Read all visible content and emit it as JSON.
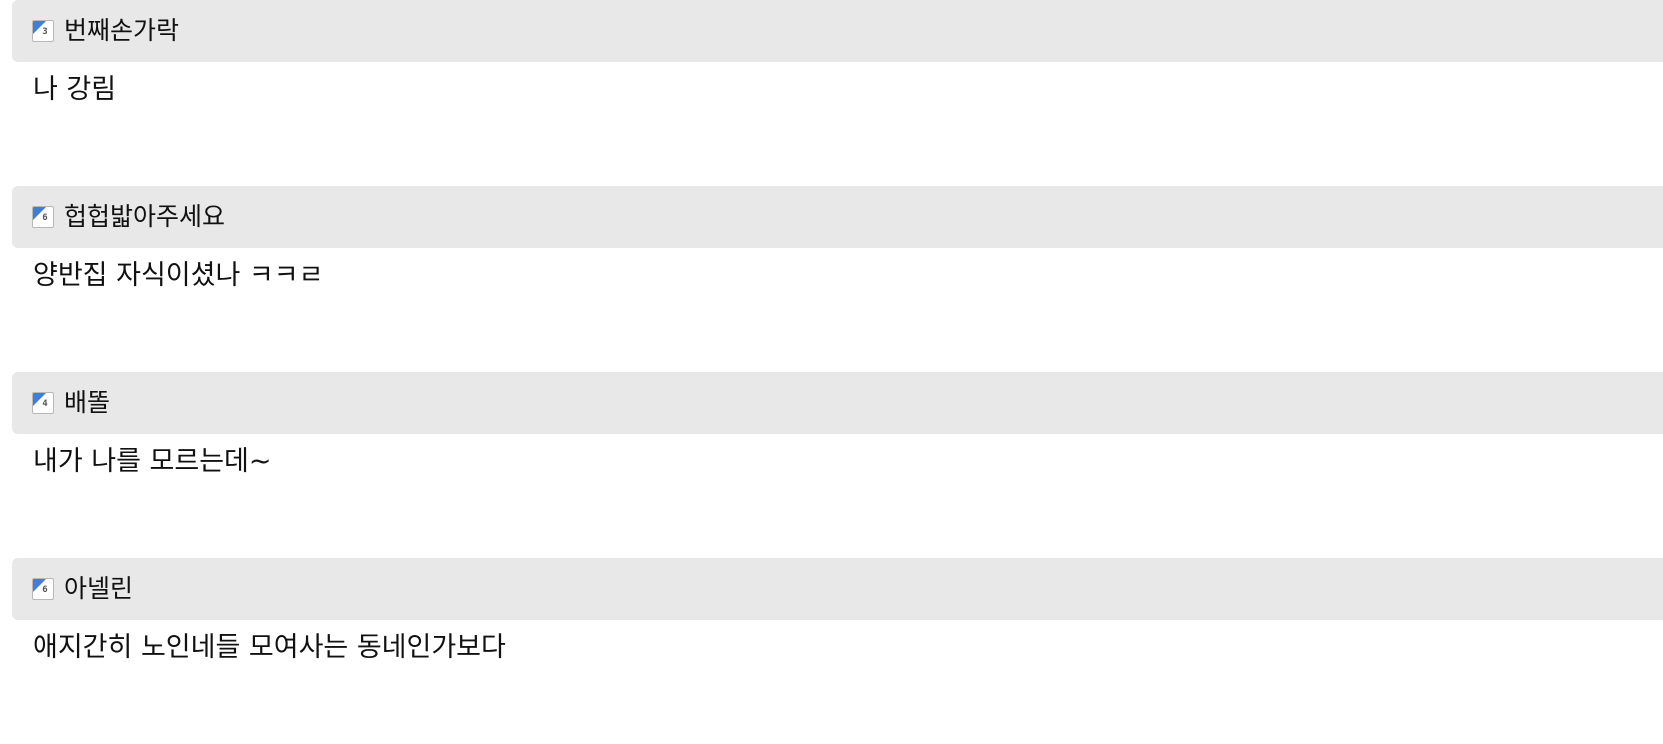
{
  "comments": [
    {
      "level": "3",
      "icon": "level-badge-icon",
      "nickname": "번째손가락",
      "text": "나 강림"
    },
    {
      "level": "6",
      "icon": "level-badge-icon",
      "nickname": "헙헙밟아주세요",
      "text": "양반집 자식이셨나 ㅋㅋㄹ"
    },
    {
      "level": "4",
      "icon": "level-badge-icon",
      "nickname": "배똘",
      "text": "내가 나를 모르는데~"
    },
    {
      "level": "6",
      "icon": "level-badge-icon",
      "nickname": "아넬린",
      "text": "애지간히 노인네들 모여사는 동네인가보다"
    }
  ],
  "colors": {
    "header_bg": "#e8e8e8",
    "badge_accent": "#3f7fd8",
    "text": "#111111"
  }
}
